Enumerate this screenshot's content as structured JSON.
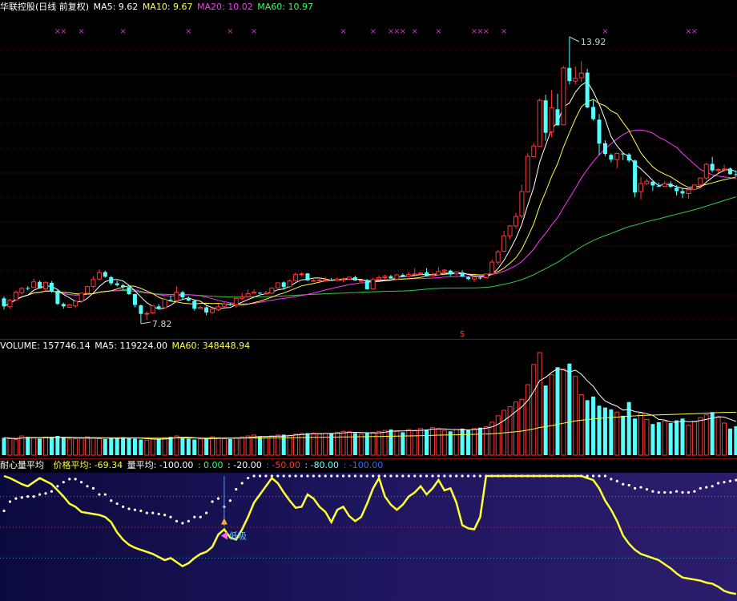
{
  "price_panel": {
    "title": "华联控股(日线 前复权)",
    "ma_labels": [
      {
        "text": "MA5: 9.62",
        "color": "#ffffff"
      },
      {
        "text": "MA10: 9.67",
        "color": "#ffff44"
      },
      {
        "text": "MA20: 10.02",
        "color": "#ff33ff"
      },
      {
        "text": "MA60: 10.97",
        "color": "#33ff66"
      }
    ],
    "high_label": "13.92",
    "low_label": "7.82",
    "signal_mark": "$"
  },
  "volume_panel": {
    "labels": [
      {
        "text": "VOLUME: 157746.14",
        "color": "#ffffff"
      },
      {
        "text": "MA5: 119224.00",
        "color": "#ffffff"
      },
      {
        "text": "MA60: 348448.94",
        "color": "#ffff44"
      }
    ]
  },
  "indicator_panel": {
    "name": "耐心量平均",
    "labels": [
      {
        "text": "价格平均: -69.34",
        "color": "#ffff44"
      },
      {
        "text": "量平均: -100.00",
        "color": "#ffffff"
      },
      {
        "text": ": 0.00",
        "color": "#33ff66"
      },
      {
        "text": ": -20.00",
        "color": "#ffffff"
      },
      {
        "text": ": -50.00",
        "color": "#ff3333"
      },
      {
        "text": ": -80.00",
        "color": "#66ffff"
      },
      {
        "text": ": -100.00",
        "color": "#3366ff"
      }
    ],
    "buy_label": "低吸"
  },
  "chart_data": [
    {
      "type": "candlestick",
      "title": "华联控股(日线 前复权)",
      "ylim": [
        7.5,
        14.1
      ],
      "ma_series": [
        "MA5",
        "MA10",
        "MA20",
        "MA60"
      ],
      "high": 13.92,
      "low": 7.82,
      "candles": [
        [
          8.36,
          8.19,
          8.4,
          8.12
        ],
        [
          8.18,
          8.32,
          8.35,
          8.14
        ],
        [
          8.33,
          8.49,
          8.52,
          8.3
        ],
        [
          8.48,
          8.57,
          8.6,
          8.44
        ],
        [
          8.58,
          8.57,
          8.62,
          8.53
        ],
        [
          8.59,
          8.71,
          8.78,
          8.59
        ],
        [
          8.71,
          8.57,
          8.74,
          8.57
        ],
        [
          8.56,
          8.7,
          8.72,
          8.53
        ],
        [
          8.69,
          8.52,
          8.73,
          8.48
        ],
        [
          8.52,
          8.24,
          8.55,
          8.22
        ],
        [
          8.24,
          8.19,
          8.27,
          8.14
        ],
        [
          8.17,
          8.22,
          8.24,
          8.16
        ],
        [
          8.2,
          8.3,
          8.3,
          8.15
        ],
        [
          8.3,
          8.47,
          8.48,
          8.27
        ],
        [
          8.47,
          8.61,
          8.63,
          8.44
        ],
        [
          8.61,
          8.76,
          8.83,
          8.58
        ],
        [
          8.77,
          8.91,
          8.98,
          8.74
        ],
        [
          8.92,
          8.82,
          8.95,
          8.8
        ],
        [
          8.81,
          8.68,
          8.84,
          8.64
        ],
        [
          8.68,
          8.64,
          8.74,
          8.61
        ],
        [
          8.64,
          8.6,
          8.67,
          8.55
        ],
        [
          8.6,
          8.45,
          8.64,
          8.43
        ],
        [
          8.45,
          8.22,
          8.46,
          8.17
        ],
        [
          8.21,
          8.03,
          8.23,
          7.82
        ],
        [
          8.03,
          8.04,
          8.08,
          7.9
        ],
        [
          8.05,
          8.2,
          8.22,
          8.03
        ],
        [
          8.19,
          8.15,
          8.24,
          8.13
        ],
        [
          8.16,
          8.34,
          8.37,
          8.14
        ],
        [
          8.33,
          8.32,
          8.42,
          8.31
        ],
        [
          8.31,
          8.49,
          8.61,
          8.28
        ],
        [
          8.49,
          8.38,
          8.52,
          8.34
        ],
        [
          8.37,
          8.31,
          8.4,
          8.3
        ],
        [
          8.31,
          8.14,
          8.32,
          8.1
        ],
        [
          8.14,
          8.17,
          8.2,
          8.13
        ],
        [
          8.17,
          8.06,
          8.19,
          8.0
        ],
        [
          8.06,
          8.13,
          8.18,
          8.03
        ],
        [
          8.12,
          8.18,
          8.24,
          8.09
        ],
        [
          8.19,
          8.24,
          8.27,
          8.16
        ],
        [
          8.24,
          8.22,
          8.26,
          8.2
        ],
        [
          8.22,
          8.36,
          8.38,
          8.16
        ],
        [
          8.36,
          8.39,
          8.48,
          8.32
        ],
        [
          8.39,
          8.46,
          8.55,
          8.39
        ],
        [
          8.47,
          8.49,
          8.55,
          8.46
        ],
        [
          8.48,
          8.47,
          8.49,
          8.45
        ],
        [
          8.47,
          8.47,
          8.52,
          8.45
        ],
        [
          8.47,
          8.58,
          8.6,
          8.45
        ],
        [
          8.58,
          8.69,
          8.69,
          8.58
        ],
        [
          8.7,
          8.6,
          8.72,
          8.54
        ],
        [
          8.61,
          8.73,
          8.76,
          8.57
        ],
        [
          8.74,
          8.87,
          8.91,
          8.71
        ],
        [
          8.88,
          8.88,
          8.91,
          8.83
        ],
        [
          8.89,
          8.74,
          8.9,
          8.73
        ],
        [
          8.73,
          8.74,
          8.77,
          8.73
        ],
        [
          8.75,
          8.75,
          8.8,
          8.72
        ],
        [
          8.75,
          8.75,
          8.81,
          8.71
        ],
        [
          8.75,
          8.74,
          8.79,
          8.73
        ],
        [
          8.74,
          8.77,
          8.81,
          8.72
        ],
        [
          8.77,
          8.77,
          8.8,
          8.7
        ],
        [
          8.77,
          8.81,
          8.82,
          8.75
        ],
        [
          8.81,
          8.74,
          8.84,
          8.73
        ],
        [
          8.74,
          8.74,
          8.76,
          8.68
        ],
        [
          8.75,
          8.55,
          8.77,
          8.55
        ],
        [
          8.56,
          8.76,
          8.8,
          8.55
        ],
        [
          8.76,
          8.8,
          8.85,
          8.75
        ],
        [
          8.8,
          8.83,
          8.86,
          8.76
        ],
        [
          8.83,
          8.78,
          8.86,
          8.78
        ],
        [
          8.77,
          8.86,
          8.88,
          8.77
        ],
        [
          8.86,
          8.83,
          8.89,
          8.82
        ],
        [
          8.83,
          8.87,
          8.92,
          8.77
        ],
        [
          8.86,
          8.88,
          9.0,
          8.86
        ],
        [
          8.88,
          8.9,
          8.92,
          8.85
        ],
        [
          8.91,
          8.84,
          9.0,
          8.83
        ],
        [
          8.84,
          8.86,
          8.91,
          8.82
        ],
        [
          8.86,
          8.93,
          9.02,
          8.86
        ],
        [
          8.94,
          8.96,
          8.98,
          8.89
        ],
        [
          8.95,
          8.87,
          8.97,
          8.83
        ],
        [
          8.88,
          8.92,
          8.94,
          8.85
        ],
        [
          8.91,
          8.82,
          8.96,
          8.82
        ],
        [
          8.81,
          8.77,
          8.83,
          8.75
        ],
        [
          8.77,
          8.81,
          8.81,
          8.71
        ],
        [
          8.8,
          8.79,
          8.82,
          8.76
        ],
        [
          8.8,
          8.88,
          8.88,
          8.79
        ],
        [
          8.88,
          9.13,
          9.18,
          8.86
        ],
        [
          9.13,
          9.35,
          9.39,
          9.08
        ],
        [
          9.36,
          9.69,
          9.8,
          9.35
        ],
        [
          9.69,
          9.9,
          9.92,
          9.62
        ],
        [
          9.9,
          10.1,
          10.18,
          9.84
        ],
        [
          10.11,
          10.63,
          10.78,
          10.06
        ],
        [
          10.62,
          11.38,
          11.45,
          10.61
        ],
        [
          11.37,
          11.6,
          11.66,
          11.35
        ],
        [
          11.59,
          12.57,
          12.61,
          11.58
        ],
        [
          12.57,
          11.88,
          12.69,
          11.71
        ],
        [
          11.9,
          12.41,
          12.79,
          11.79
        ],
        [
          12.38,
          12.04,
          12.71,
          12.03
        ],
        [
          12.05,
          13.26,
          13.3,
          12.07
        ],
        [
          13.26,
          12.98,
          13.92,
          12.91
        ],
        [
          12.98,
          13.04,
          13.29,
          12.91
        ],
        [
          13.05,
          13.15,
          13.4,
          12.96
        ],
        [
          13.16,
          12.42,
          13.24,
          12.4
        ],
        [
          12.43,
          12.17,
          12.59,
          12.14
        ],
        [
          12.16,
          11.65,
          12.28,
          11.4
        ],
        [
          11.66,
          11.43,
          11.72,
          11.38
        ],
        [
          11.41,
          11.31,
          11.44,
          11.25
        ],
        [
          11.31,
          11.44,
          11.46,
          11.13
        ],
        [
          11.44,
          11.42,
          11.47,
          11.3
        ],
        [
          11.42,
          11.29,
          11.45,
          11.25
        ],
        [
          11.29,
          10.61,
          11.31,
          10.51
        ],
        [
          10.63,
          10.8,
          10.94,
          10.46
        ],
        [
          10.8,
          10.85,
          10.9,
          10.77
        ],
        [
          10.84,
          10.76,
          10.87,
          10.65
        ],
        [
          10.75,
          10.74,
          10.82,
          10.74
        ],
        [
          10.74,
          10.8,
          10.85,
          10.73
        ],
        [
          10.8,
          10.73,
          10.85,
          10.71
        ],
        [
          10.71,
          10.64,
          10.77,
          10.55
        ],
        [
          10.64,
          10.59,
          10.7,
          10.49
        ],
        [
          10.59,
          10.67,
          10.69,
          10.48
        ],
        [
          10.68,
          10.77,
          10.79,
          10.67
        ],
        [
          10.77,
          10.92,
          10.92,
          10.73
        ],
        [
          10.92,
          11.21,
          11.24,
          10.87
        ],
        [
          11.22,
          11.08,
          11.37,
          11.04
        ],
        [
          11.08,
          11.1,
          11.12,
          11.03
        ],
        [
          11.11,
          11.11,
          11.2,
          11.05
        ],
        [
          11.12,
          11.0,
          11.14,
          10.99
        ],
        [
          11.0,
          10.98,
          11.08,
          10.96
        ]
      ]
    },
    {
      "type": "bar",
      "title": "VOLUME",
      "ylim": [
        0,
        560000
      ],
      "values": [
        95000,
        90000,
        85000,
        105000,
        100000,
        95000,
        90000,
        98000,
        100000,
        105000,
        95000,
        88000,
        90000,
        92000,
        100000,
        95000,
        90000,
        88000,
        92000,
        95000,
        98000,
        95000,
        90000,
        85000,
        82000,
        88000,
        90000,
        95000,
        100000,
        105000,
        95000,
        90000,
        85000,
        88000,
        90000,
        100000,
        95000,
        90000,
        88000,
        95000,
        100000,
        105000,
        110000,
        100000,
        95000,
        105000,
        110000,
        112000,
        108000,
        115000,
        118000,
        120000,
        120000,
        115000,
        118000,
        120000,
        125000,
        130000,
        128000,
        120000,
        115000,
        120000,
        125000,
        130000,
        135000,
        140000,
        130000,
        125000,
        140000,
        135000,
        145000,
        140000,
        150000,
        145000,
        135000,
        130000,
        140000,
        145000,
        140000,
        145000,
        150000,
        155000,
        180000,
        215000,
        245000,
        265000,
        290000,
        305000,
        385000,
        495000,
        560000,
        380000,
        440000,
        480000,
        470000,
        500000,
        430000,
        330000,
        300000,
        320000,
        270000,
        260000,
        250000,
        235000,
        215000,
        290000,
        200000,
        230000,
        195000,
        170000,
        180000,
        185000,
        175000,
        190000,
        200000,
        165000,
        185000,
        205000,
        220000,
        235000,
        205000,
        175000,
        145000,
        158000
      ]
    },
    {
      "type": "line",
      "title": "耐心量平均",
      "ylim": [
        -110,
        0
      ],
      "series": [
        {
          "name": "价格平均",
          "values": [
            0,
            -2,
            -5,
            -8,
            -10,
            -6,
            -2,
            -5,
            -8,
            -14,
            -20,
            -27,
            -30,
            -35,
            -36,
            -37,
            -38,
            -40,
            -45,
            -55,
            -62,
            -67,
            -70,
            -72,
            -74,
            -76,
            -79,
            -82,
            -80,
            -84,
            -88,
            -85,
            -80,
            -76,
            -74,
            -69,
            -57,
            -52,
            -60,
            -62,
            -52,
            -40,
            -26,
            -18,
            -10,
            -2,
            -7,
            -16,
            -24,
            -31,
            -30,
            -18,
            -22,
            -30,
            -35,
            -45,
            -33,
            -30,
            -39,
            -44,
            -40,
            -27,
            -12,
            -2,
            -20,
            -28,
            -33,
            -28,
            -20,
            -16,
            -10,
            -18,
            -12,
            -4,
            -14,
            -12,
            -26,
            -48,
            -51,
            -52,
            -40,
            0,
            0,
            0,
            0,
            0,
            0,
            0,
            0,
            0,
            0,
            0,
            0,
            0,
            0,
            0,
            0,
            0,
            -2,
            -4,
            -12,
            -24,
            -33,
            -44,
            -58,
            -66,
            -72,
            -76,
            -78,
            -80,
            -82,
            -86,
            -90,
            -95,
            -99,
            -100,
            -101,
            -102,
            -104,
            -105,
            -108,
            -112,
            -114,
            -115
          ]
        },
        {
          "name": "量平均",
          "values": [
            -34,
            -25,
            -22,
            -21,
            -20,
            -20,
            -18,
            -17,
            -15,
            -10,
            -6,
            -3,
            -3,
            -6,
            -10,
            -12,
            -18,
            -18,
            -24,
            -27,
            -30,
            -32,
            -33,
            -34,
            -36,
            -36,
            -37,
            -38,
            -40,
            -44,
            -46,
            -44,
            -40,
            -40,
            -36,
            -25,
            -22,
            -30,
            -24,
            -13,
            -7,
            -2,
            0,
            0,
            0,
            0,
            0,
            0,
            0,
            0,
            0,
            0,
            0,
            0,
            0,
            0,
            0,
            0,
            0,
            0,
            0,
            0,
            0,
            0,
            0,
            0,
            0,
            0,
            0,
            0,
            0,
            0,
            0,
            0,
            0,
            0,
            0,
            0,
            0,
            0,
            0,
            0,
            0,
            0,
            0,
            0,
            0,
            0,
            0,
            0,
            0,
            0,
            0,
            0,
            0,
            0,
            0,
            0,
            0,
            0,
            0,
            0,
            -3,
            -5,
            -8,
            -9,
            -12,
            -11,
            -13,
            -15,
            -16,
            -16,
            -16,
            -15,
            -16,
            -16,
            -15,
            -12,
            -11,
            -10,
            -7,
            -6,
            -5,
            -4
          ]
        }
      ],
      "buy_signal": {
        "index": 37,
        "label": "低吸"
      }
    }
  ]
}
